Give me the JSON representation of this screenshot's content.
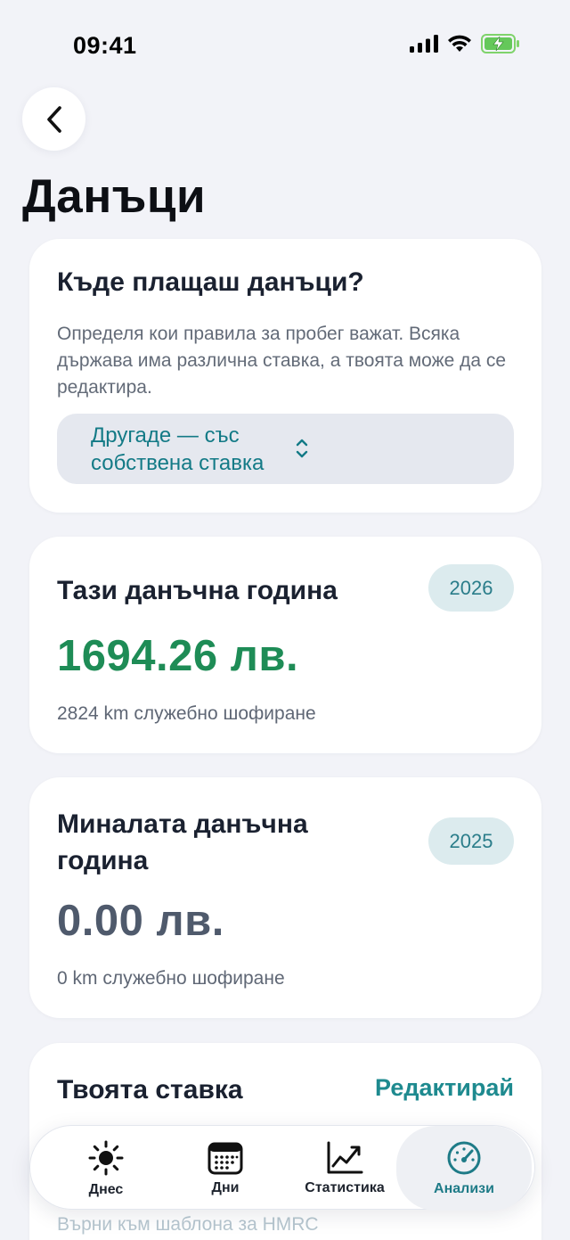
{
  "status_bar": {
    "time": "09:41"
  },
  "page": {
    "title": "Данъци"
  },
  "region_card": {
    "title": "Къде плащаш данъци?",
    "description": "Определя кои правила за пробег важат. Всяка държава има различна ставка, а твоята може да се редактира.",
    "selected_option": "Другаде — със собствена ставка"
  },
  "this_year_card": {
    "title": "Тази данъчна година",
    "year": "2026",
    "amount": "1694.26 лв.",
    "subtitle": "2824 km служебно шофиране"
  },
  "last_year_card": {
    "title": "Миналата данъчна година",
    "year": "2025",
    "amount": "0.00 лв.",
    "subtitle": "0 km служебно шофиране"
  },
  "rate_card": {
    "title": "Твоята ставка",
    "edit_label": "Редактирай",
    "reset_link": "Върни към шаблона за HMRC"
  },
  "tab_bar": {
    "tabs": [
      {
        "label": "Днес",
        "icon": "sun-icon"
      },
      {
        "label": "Дни",
        "icon": "calendar-icon"
      },
      {
        "label": "Статистика",
        "icon": "chart-icon"
      },
      {
        "label": "Анализи",
        "icon": "gauge-icon",
        "active": true
      }
    ]
  },
  "colors": {
    "accent": "#1e8a8f",
    "positive_amount": "#1e8c56",
    "background": "#f2f3f8"
  }
}
